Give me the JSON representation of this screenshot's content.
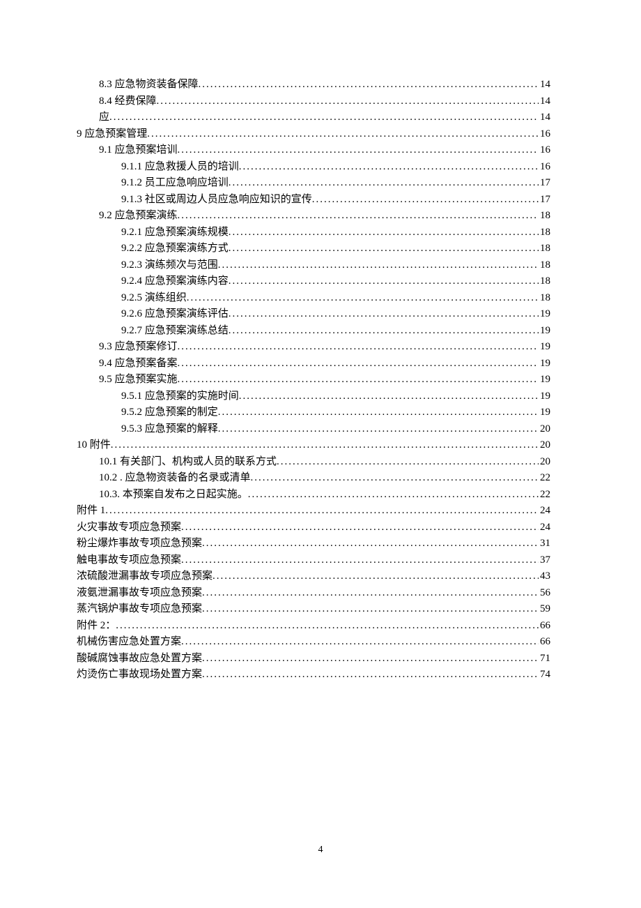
{
  "toc": [
    {
      "level": 2,
      "title": "8.3 应急物资装备保障",
      "page": "14"
    },
    {
      "level": 2,
      "title": "8.4 经费保障",
      "page": "14"
    },
    {
      "level": 2,
      "title": "应",
      "page": "14"
    },
    {
      "level": 1,
      "title": "9 应急预案管理",
      "page": "16"
    },
    {
      "level": 2,
      "title": "9.1 应急预案培训",
      "page": "16"
    },
    {
      "level": 3,
      "title": "9.1.1 应急救援人员的培训",
      "page": "16"
    },
    {
      "level": 3,
      "title": "9.1.2 员工应急响应培训",
      "page": "17"
    },
    {
      "level": 3,
      "title": "9.1.3 社区或周边人员应急响应知识的宣传",
      "page": "17"
    },
    {
      "level": 2,
      "title": "9.2 应急预案演练",
      "page": "18"
    },
    {
      "level": 3,
      "title": "9.2.1 应急预案演练规模",
      "page": "18"
    },
    {
      "level": 3,
      "title": "9.2.2 应急预案演练方式",
      "page": "18"
    },
    {
      "level": 3,
      "title": "9.2.3 演练频次与范围",
      "page": "18"
    },
    {
      "level": 3,
      "title": "9.2.4 应急预案演练内容",
      "page": "18"
    },
    {
      "level": 3,
      "title": "9.2.5 演练组织",
      "page": "18"
    },
    {
      "level": 3,
      "title": "9.2.6 应急预案演练评估",
      "page": "19"
    },
    {
      "level": 3,
      "title": "9.2.7 应急预案演练总结",
      "page": "19"
    },
    {
      "level": 2,
      "title": "9.3 应急预案修订",
      "page": "19"
    },
    {
      "level": 2,
      "title": "9.4 应急预案备案",
      "page": "19"
    },
    {
      "level": 2,
      "title": "9.5 应急预案实施",
      "page": "19"
    },
    {
      "level": 3,
      "title": "9.5.1 应急预案的实施时间",
      "page": "19"
    },
    {
      "level": 3,
      "title": "9.5.2 应急预案的制定",
      "page": "19"
    },
    {
      "level": 3,
      "title": "9.5.3 应急预案的解释",
      "page": "20"
    },
    {
      "level": 1,
      "title": "10 附件",
      "page": "20"
    },
    {
      "level": 2,
      "title": "10.1 有关部门、机构或人员的联系方式",
      "page": "20"
    },
    {
      "level": 2,
      "title": "10.2 . 应急物资装备的名录或清单",
      "page": "22"
    },
    {
      "level": 2,
      "title": "10.3. 本预案自发布之日起实施。",
      "page": "22"
    },
    {
      "level": 1,
      "title": "附件 1",
      "page": "24"
    },
    {
      "level": 1,
      "title": "火灾事故专项应急预案",
      "page": "24"
    },
    {
      "level": 1,
      "title": "粉尘爆炸事故专项应急预案",
      "page": "31"
    },
    {
      "level": 1,
      "title": "触电事故专项应急预案",
      "page": "37"
    },
    {
      "level": 1,
      "title": "浓硫酸泄漏事故专项应急预案",
      "page": "43"
    },
    {
      "level": 1,
      "title": "液氨泄漏事故专项应急预案",
      "page": "56"
    },
    {
      "level": 1,
      "title": "蒸汽锅炉事故专项应急预案",
      "page": "59"
    },
    {
      "level": 1,
      "title": "附件 2：",
      "page": "66"
    },
    {
      "level": 1,
      "title": "机械伤害应急处置方案",
      "page": "66"
    },
    {
      "level": 1,
      "title": "酸碱腐蚀事故应急处置方案",
      "page": "71"
    },
    {
      "level": 1,
      "title": "灼烫伤亡事故现场处置方案",
      "page": "74"
    }
  ],
  "page_number": "4"
}
